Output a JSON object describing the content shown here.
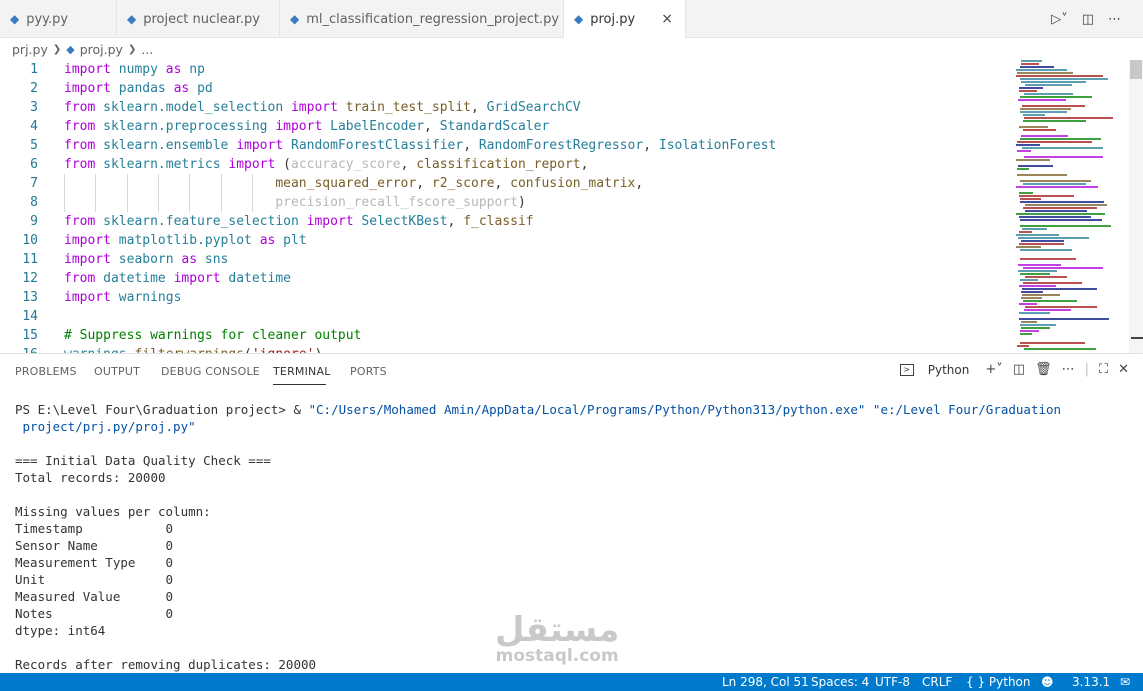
{
  "tabs": [
    {
      "label": "pyy.py",
      "active": false
    },
    {
      "label": "project nuclear.py",
      "active": false
    },
    {
      "label": "ml_classification_regression_project.py",
      "active": false
    },
    {
      "label": "proj.py",
      "active": true
    }
  ],
  "tab_close_glyph": "×",
  "breadcrumb": {
    "folder": "prj.py",
    "file": "proj.py",
    "symbol": "..."
  },
  "editor": {
    "line_numbers": [
      "1",
      "2",
      "3",
      "4",
      "5",
      "6",
      "7",
      "8",
      "9",
      "10",
      "11",
      "12",
      "13",
      "14",
      "15",
      "16"
    ],
    "lines": [
      [
        {
          "t": "import",
          "c": "kw"
        },
        {
          "t": " numpy ",
          "c": "mod"
        },
        {
          "t": "as",
          "c": "kw"
        },
        {
          "t": " np",
          "c": "mod"
        }
      ],
      [
        {
          "t": "import",
          "c": "kw"
        },
        {
          "t": " pandas ",
          "c": "mod"
        },
        {
          "t": "as",
          "c": "kw"
        },
        {
          "t": " pd",
          "c": "mod"
        }
      ],
      [
        {
          "t": "from",
          "c": "kw"
        },
        {
          "t": " sklearn.model_selection ",
          "c": "mod"
        },
        {
          "t": "import",
          "c": "kw"
        },
        {
          "t": " train_test_split",
          "c": "fn"
        },
        {
          "t": ", ",
          "c": "pun"
        },
        {
          "t": "GridSearchCV",
          "c": "cls"
        }
      ],
      [
        {
          "t": "from",
          "c": "kw"
        },
        {
          "t": " sklearn.preprocessing ",
          "c": "mod"
        },
        {
          "t": "import",
          "c": "kw"
        },
        {
          "t": " LabelEncoder",
          "c": "cls"
        },
        {
          "t": ", ",
          "c": "pun"
        },
        {
          "t": "StandardScaler",
          "c": "cls"
        }
      ],
      [
        {
          "t": "from",
          "c": "kw"
        },
        {
          "t": " sklearn.ensemble ",
          "c": "mod"
        },
        {
          "t": "import",
          "c": "kw"
        },
        {
          "t": " RandomForestClassifier",
          "c": "cls"
        },
        {
          "t": ", ",
          "c": "pun"
        },
        {
          "t": "RandomForestRegressor",
          "c": "cls"
        },
        {
          "t": ", ",
          "c": "pun"
        },
        {
          "t": "IsolationForest",
          "c": "cls"
        }
      ],
      [
        {
          "t": "from",
          "c": "kw"
        },
        {
          "t": " sklearn.metrics ",
          "c": "mod"
        },
        {
          "t": "import",
          "c": "kw"
        },
        {
          "t": " (",
          "c": "pun"
        },
        {
          "t": "accuracy_score",
          "c": "dim"
        },
        {
          "t": ", ",
          "c": "pun"
        },
        {
          "t": "classification_report",
          "c": "fn"
        },
        {
          "t": ",",
          "c": "pun"
        }
      ],
      [
        {
          "t": "                           ",
          "c": "pun"
        },
        {
          "t": "mean_squared_error",
          "c": "fn"
        },
        {
          "t": ", ",
          "c": "pun"
        },
        {
          "t": "r2_score",
          "c": "fn"
        },
        {
          "t": ", ",
          "c": "pun"
        },
        {
          "t": "confusion_matrix",
          "c": "fn"
        },
        {
          "t": ",",
          "c": "pun"
        }
      ],
      [
        {
          "t": "                           ",
          "c": "pun"
        },
        {
          "t": "precision_recall_fscore_support",
          "c": "dim"
        },
        {
          "t": ")",
          "c": "pun"
        }
      ],
      [
        {
          "t": "from",
          "c": "kw"
        },
        {
          "t": " sklearn.feature_selection ",
          "c": "mod"
        },
        {
          "t": "import",
          "c": "kw"
        },
        {
          "t": " SelectKBest",
          "c": "cls"
        },
        {
          "t": ", ",
          "c": "pun"
        },
        {
          "t": "f_classif",
          "c": "fn"
        }
      ],
      [
        {
          "t": "import",
          "c": "kw"
        },
        {
          "t": " matplotlib.pyplot ",
          "c": "mod"
        },
        {
          "t": "as",
          "c": "kw"
        },
        {
          "t": " plt",
          "c": "mod"
        }
      ],
      [
        {
          "t": "import",
          "c": "kw"
        },
        {
          "t": " seaborn ",
          "c": "mod"
        },
        {
          "t": "as",
          "c": "kw"
        },
        {
          "t": " sns",
          "c": "mod"
        }
      ],
      [
        {
          "t": "from",
          "c": "kw"
        },
        {
          "t": " datetime ",
          "c": "mod"
        },
        {
          "t": "import",
          "c": "kw"
        },
        {
          "t": " datetime",
          "c": "cls"
        }
      ],
      [
        {
          "t": "import",
          "c": "kw"
        },
        {
          "t": " warnings",
          "c": "mod"
        }
      ],
      [],
      [
        {
          "t": "# Suppress warnings for cleaner output",
          "c": "cm"
        }
      ],
      [
        {
          "t": "warnings",
          "c": "mod"
        },
        {
          "t": ".",
          "c": "pun"
        },
        {
          "t": "filterwarnings",
          "c": "fn"
        },
        {
          "t": "(",
          "c": "pun"
        },
        {
          "t": "'ignore'",
          "c": "str"
        },
        {
          "t": ")",
          "c": "pun"
        }
      ]
    ]
  },
  "panel": {
    "tabs": [
      "PROBLEMS",
      "OUTPUT",
      "DEBUG CONSOLE",
      "TERMINAL",
      "PORTS"
    ],
    "active_tab": "TERMINAL",
    "terminal_label": "Python"
  },
  "terminal": {
    "prompt": "PS E:\\Level Four\\Graduation project> & ",
    "command_path": "\"C:/Users/Mohamed Amin/AppData/Local/Programs/Python/Python313/python.exe\" \"e:/Level Four/Graduation",
    "command_path_cont": " project/prj.py/proj.py\"",
    "output_lines": [
      "",
      "=== Initial Data Quality Check ===",
      "Total records: 20000",
      "",
      "Missing values per column:",
      "Timestamp           0",
      "Sensor Name         0",
      "Measurement Type    0",
      "Unit                0",
      "Measured Value      0",
      "Notes               0",
      "dtype: int64",
      "",
      "Records after removing duplicates: 20000"
    ]
  },
  "statusbar": {
    "position": "Ln 298, Col 51",
    "spaces": "Spaces: 4",
    "encoding": "UTF-8",
    "eol": "CRLF",
    "language": "{ } Python",
    "version": "3.13.1"
  },
  "watermark": {
    "arabic": "مستقل",
    "latin": "mostaql.com"
  },
  "colors": {
    "statusbar_bg": "#007acc",
    "keyword": "#af00db",
    "module": "#267f99",
    "function": "#795e26",
    "comment": "#008000",
    "string": "#a31515",
    "line_number": "#237893"
  }
}
